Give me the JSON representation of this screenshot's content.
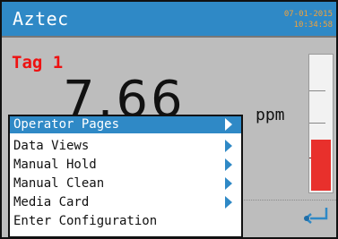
{
  "header": {
    "title": "Aztec",
    "date": "07-01-2015",
    "time": "10:34:58"
  },
  "reading": {
    "tag": "Tag 1",
    "value": "7.66",
    "unit": "ppm",
    "level_fraction": 0.38
  },
  "colors": {
    "title_bar": "#2f89c6",
    "clock_text": "#f2a23a",
    "tag_text": "#ee1111",
    "bar_fill": "#e8302c",
    "menu_highlight": "#2f89c6",
    "screen_background": "#bdbdbd"
  },
  "menu": {
    "items": [
      {
        "label": "Operator Pages",
        "has_submenu": true,
        "selected": true
      },
      {
        "label": "Data Views",
        "has_submenu": true,
        "selected": false
      },
      {
        "label": "Manual Hold",
        "has_submenu": true,
        "selected": false
      },
      {
        "label": "Manual Clean",
        "has_submenu": true,
        "selected": false
      },
      {
        "label": "Media Card",
        "has_submenu": true,
        "selected": false
      },
      {
        "label": "Enter Configuration",
        "has_submenu": false,
        "selected": false
      }
    ]
  },
  "icons": {
    "enter": "enter-key-icon",
    "submenu": "chevron-right-icon"
  }
}
